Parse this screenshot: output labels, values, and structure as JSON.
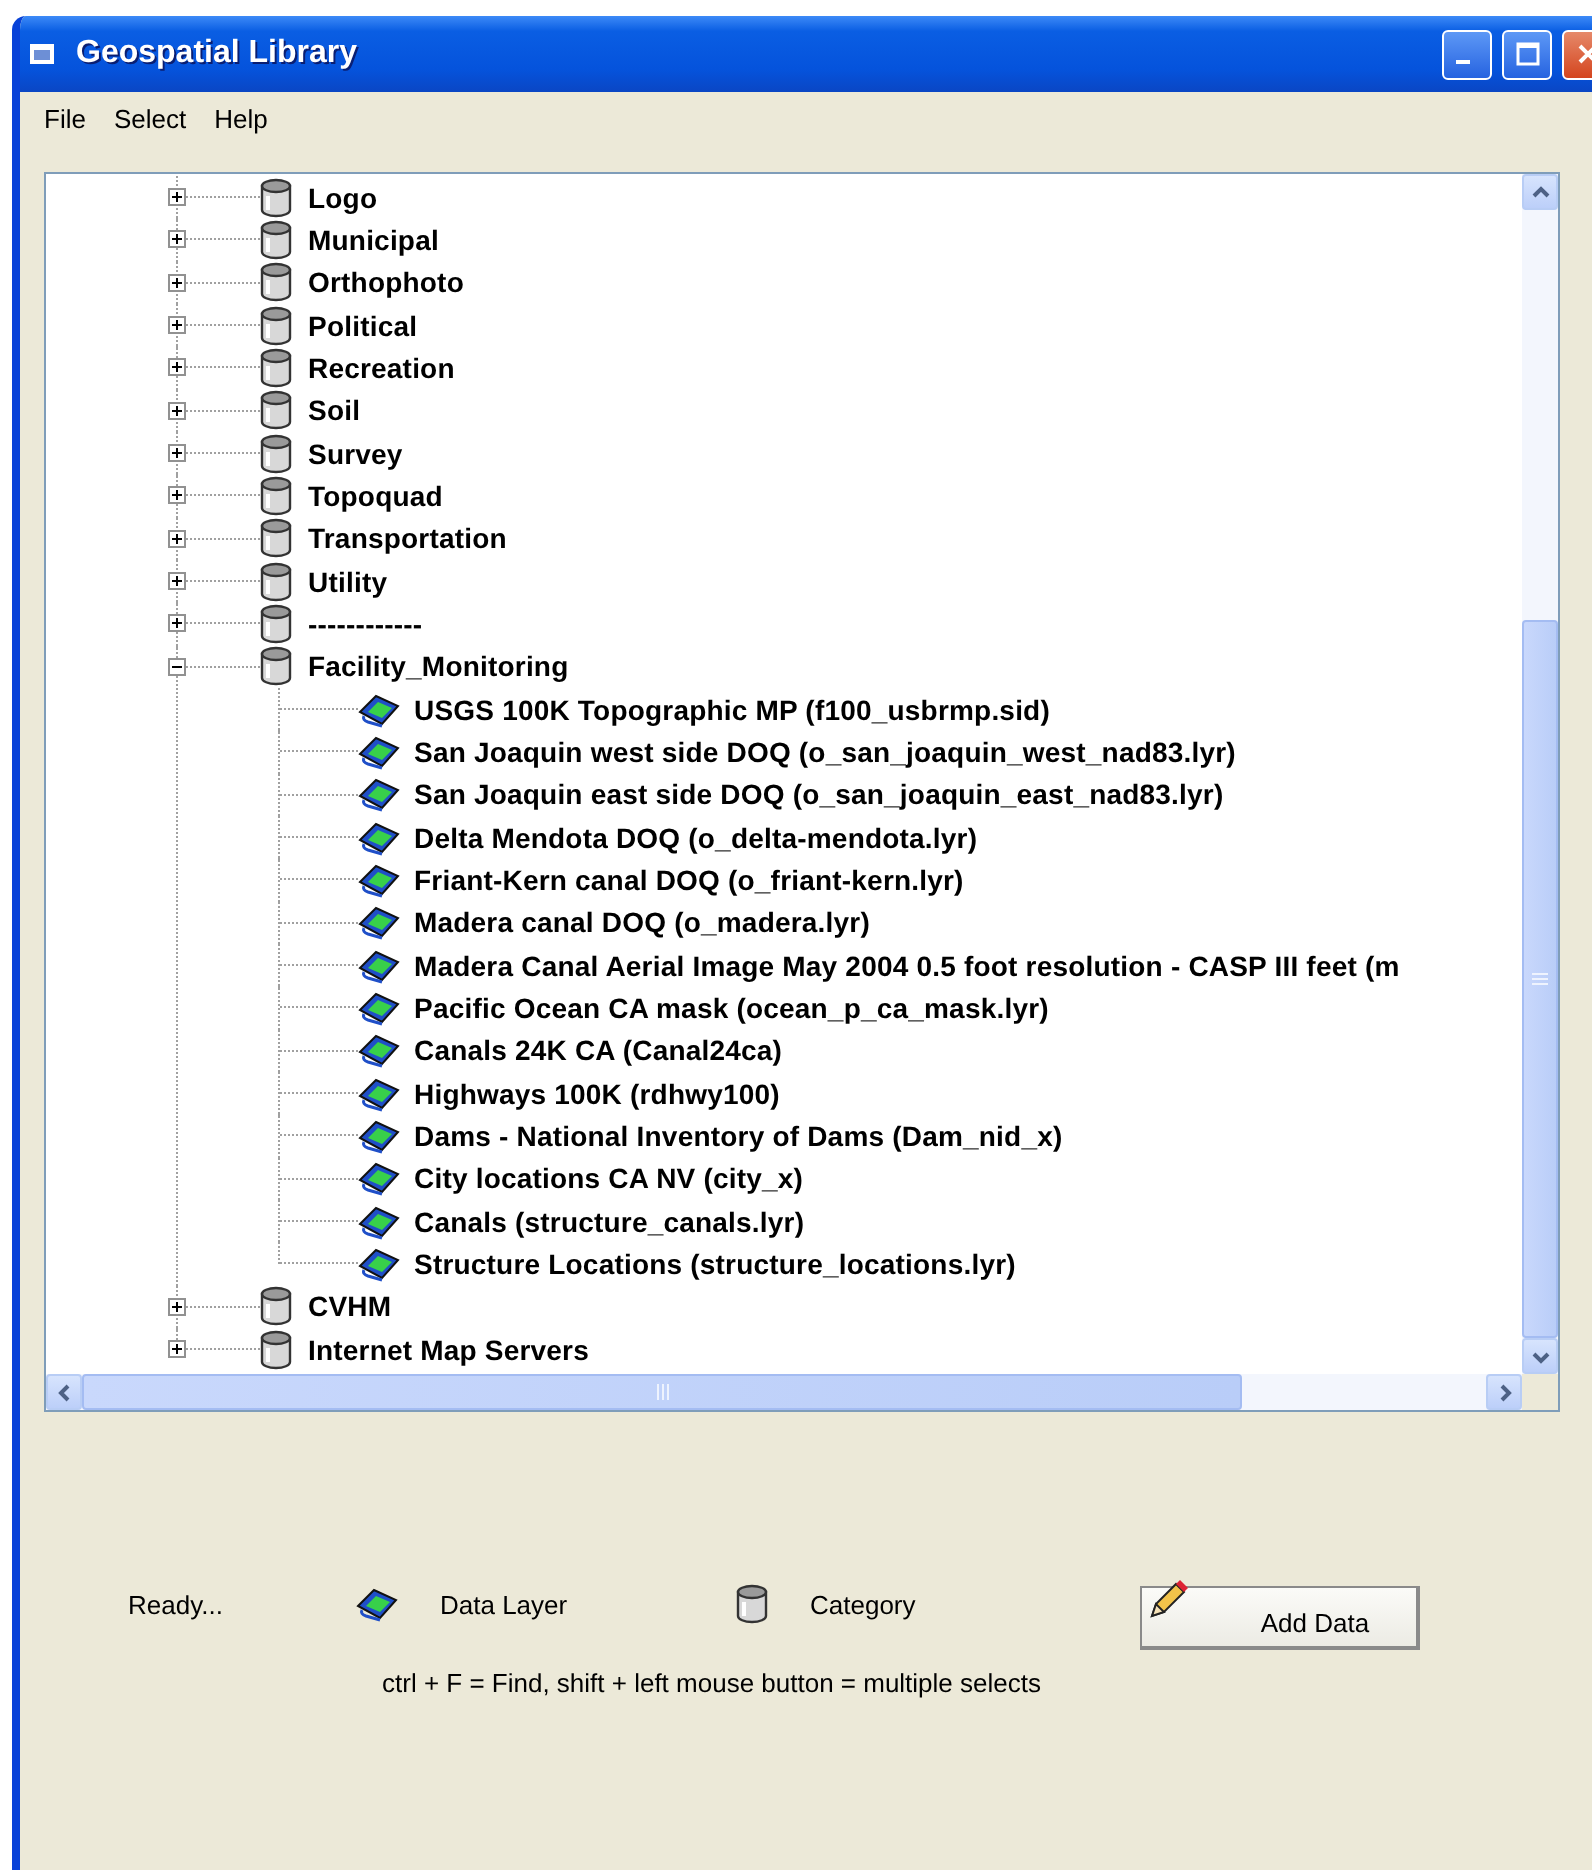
{
  "window": {
    "title": "Geospatial Library"
  },
  "menu": [
    {
      "label": "File"
    },
    {
      "label": "Select"
    },
    {
      "label": "Help"
    }
  ],
  "tree": {
    "items": [
      {
        "kind": "category",
        "label": "Logo",
        "expanded": false
      },
      {
        "kind": "category",
        "label": "Municipal",
        "expanded": false
      },
      {
        "kind": "category",
        "label": "Orthophoto",
        "expanded": false
      },
      {
        "kind": "category",
        "label": "Political",
        "expanded": false
      },
      {
        "kind": "category",
        "label": "Recreation",
        "expanded": false
      },
      {
        "kind": "category",
        "label": "Soil",
        "expanded": false
      },
      {
        "kind": "category",
        "label": "Survey",
        "expanded": false
      },
      {
        "kind": "category",
        "label": "Topoquad",
        "expanded": false
      },
      {
        "kind": "category",
        "label": "Transportation",
        "expanded": false
      },
      {
        "kind": "category",
        "label": "Utility",
        "expanded": false
      },
      {
        "kind": "category",
        "label": "------------",
        "expanded": false
      },
      {
        "kind": "category",
        "label": "Facility_Monitoring",
        "expanded": true,
        "children": [
          {
            "kind": "layer",
            "label": "USGS 100K Topographic MP (f100_usbrmp.sid)"
          },
          {
            "kind": "layer",
            "label": "San Joaquin west side DOQ (o_san_joaquin_west_nad83.lyr)"
          },
          {
            "kind": "layer",
            "label": "San Joaquin east side DOQ (o_san_joaquin_east_nad83.lyr)"
          },
          {
            "kind": "layer",
            "label": "Delta Mendota DOQ (o_delta-mendota.lyr)"
          },
          {
            "kind": "layer",
            "label": "Friant-Kern canal DOQ (o_friant-kern.lyr)"
          },
          {
            "kind": "layer",
            "label": "Madera canal DOQ (o_madera.lyr)"
          },
          {
            "kind": "layer",
            "label": "Madera Canal Aerial Image May 2004 0.5 foot resolution - CASP III feet (m"
          },
          {
            "kind": "layer",
            "label": "Pacific Ocean CA mask (ocean_p_ca_mask.lyr)"
          },
          {
            "kind": "layer",
            "label": "Canals 24K CA (Canal24ca)"
          },
          {
            "kind": "layer",
            "label": "Highways 100K (rdhwy100)"
          },
          {
            "kind": "layer",
            "label": "Dams - National Inventory of Dams (Dam_nid_x)"
          },
          {
            "kind": "layer",
            "label": "City locations CA NV (city_x)"
          },
          {
            "kind": "layer",
            "label": "Canals (structure_canals.lyr)"
          },
          {
            "kind": "layer",
            "label": "Structure Locations (structure_locations.lyr)"
          }
        ]
      },
      {
        "kind": "category",
        "label": "CVHM",
        "expanded": false
      },
      {
        "kind": "category",
        "label": "Internet Map Servers",
        "expanded": false
      }
    ]
  },
  "status": "Ready...",
  "legend": [
    {
      "kind": "layer",
      "label": "Data Layer"
    },
    {
      "kind": "category",
      "label": "Category"
    }
  ],
  "add_button": {
    "label": "Add Data"
  },
  "hint": "ctrl + F = Find, shift + left mouse button = multiple selects"
}
